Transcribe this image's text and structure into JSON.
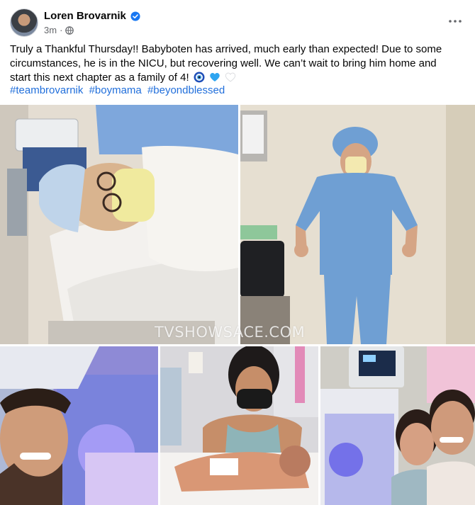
{
  "post": {
    "author": "Loren Brovarnik",
    "verified_icon": "verified-badge-icon",
    "time": "3m",
    "separator": "·",
    "audience_icon": "globe-icon",
    "more_icon": "more-options-icon",
    "text": "Truly a Thankful Thursday!! Babyboten has arrived, much early than expected! Due to some circumstances, he is in the NICU, but recovering well. We can’t wait to bring him home and start this next chapter as a family of 4!",
    "emojis": [
      "nazar-amulet-emoji",
      "blue-heart-emoji",
      "white-heart-emoji"
    ],
    "hashtags": [
      "#teambrovarnik",
      "#boymama",
      "#beyondblessed"
    ]
  },
  "photos": {
    "watermark": "TVSHOWSACE.COM",
    "items": [
      {
        "id": "hospital-bed-photo"
      },
      {
        "id": "scrubs-photo"
      },
      {
        "id": "incubator-selfie-photo"
      },
      {
        "id": "mother-holding-baby-photo"
      },
      {
        "id": "couple-selfie-photo"
      }
    ]
  },
  "colors": {
    "text": "#050505",
    "secondary": "#65676b",
    "link": "#216fdb",
    "verified": "#1877f2",
    "scrubs": "#6f9fd3"
  }
}
